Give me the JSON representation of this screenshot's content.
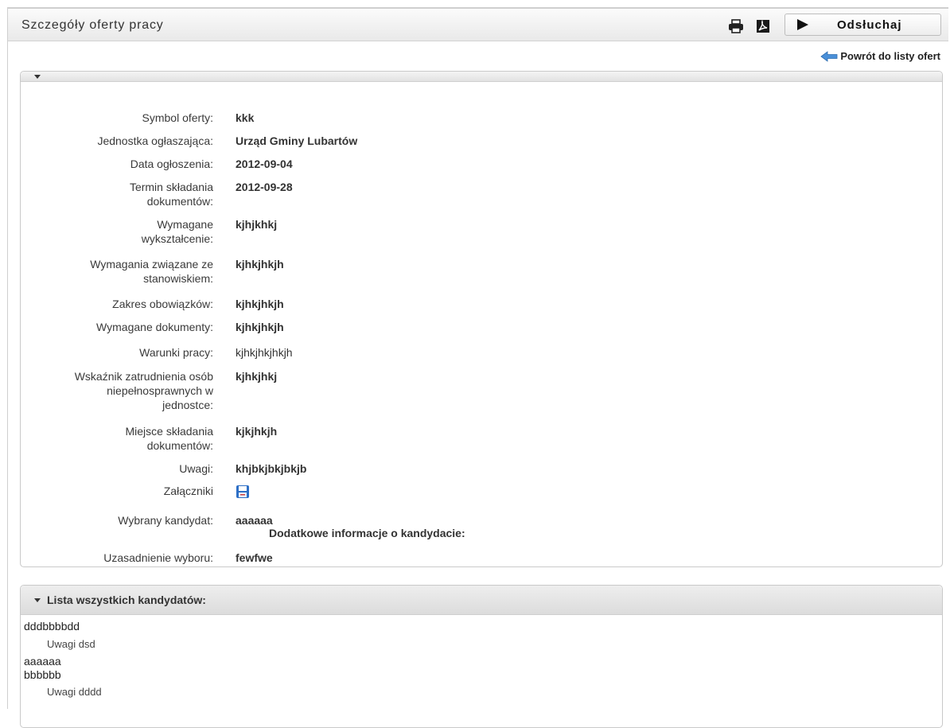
{
  "header": {
    "title": "Szczegóły oferty pracy",
    "listen_label": "Odsłuchaj",
    "back_link": "Powrót do listy ofert"
  },
  "details": [
    {
      "label": "Symbol oferty:",
      "value": "kkk"
    },
    {
      "label": "Jednostka ogłaszająca:",
      "value": "Urząd Gminy Lubartów"
    },
    {
      "label": "Data ogłoszenia:",
      "value": "2012-09-04"
    },
    {
      "label": "Termin składania dokumentów:",
      "value": "2012-09-28"
    },
    {
      "label": "Wymagane wykształcenie:",
      "value": "kjhjkhkj"
    },
    {
      "label": "Wymagania związane ze stanowiskiem:",
      "value": "kjhkjhkjh"
    },
    {
      "label": "Zakres obowiązków:",
      "value": "kjhkjhkjh"
    },
    {
      "label": "Wymagane dokumenty:",
      "value": "kjhkjhkjh"
    },
    {
      "label": "Warunki pracy:",
      "value": "kjhkjhkjhkjh"
    },
    {
      "label": "Wskaźnik zatrudnienia osób niepełnosprawnych w jednostce:",
      "value": "kjhkjhkj"
    },
    {
      "label": "Miejsce składania dokumentów:",
      "value": "kjkjhkjh"
    },
    {
      "label": "Uwagi:",
      "value": "khjbkjbkjbkjb"
    },
    {
      "label": "Załączniki",
      "value": ""
    },
    {
      "label": "Wybrany kandydat:",
      "value": "aaaaaa",
      "extra": "Dodatkowe informacje o kandydacie:"
    },
    {
      "label": "Uzasadnienie wyboru:",
      "value": "fewfwe"
    }
  ],
  "candidates": {
    "title": "Lista wszystkich kandydatów:",
    "items": [
      {
        "name": "dddbbbbdd",
        "note": "Uwagi dsd"
      },
      {
        "name": "aaaaaa",
        "note": ""
      },
      {
        "name": "bbbbbb",
        "note": "Uwagi dddd"
      }
    ]
  },
  "icons": {
    "print": "printer-icon",
    "pdf": "pdf-icon",
    "play": "play-icon",
    "back": "arrow-left-icon",
    "attachment": "floppy-disk-icon"
  },
  "colors": {
    "back_arrow": "#4a90d9",
    "attachment_icon": "#2d6fc6"
  }
}
